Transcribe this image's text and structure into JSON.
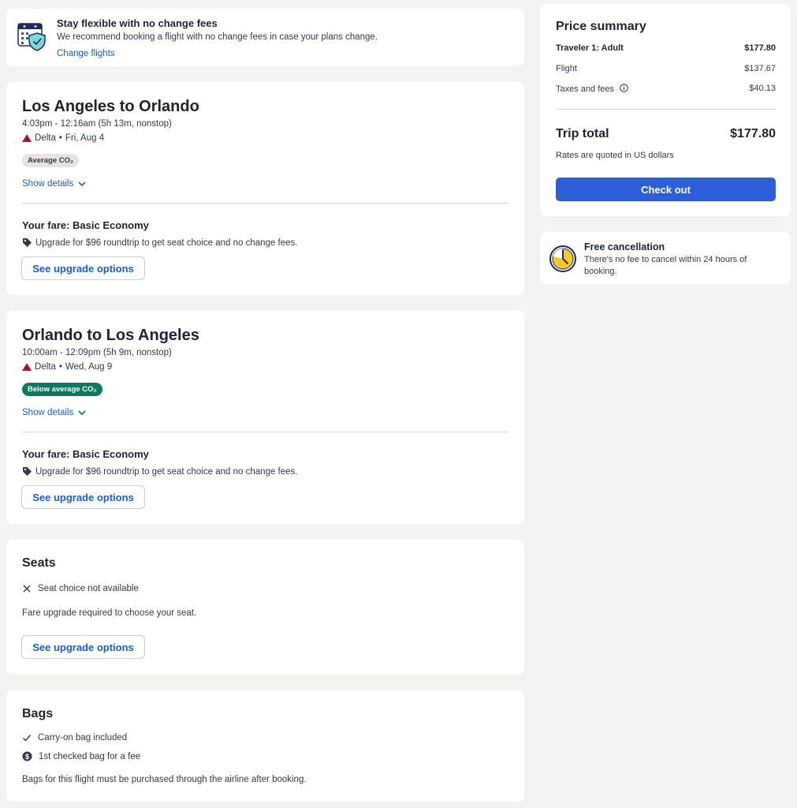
{
  "banner": {
    "title": "Stay flexible with no change fees",
    "text": "We recommend booking a flight with no change fees in case your plans change.",
    "link": "Change flights",
    "icon": "calendar-shield-icon"
  },
  "flights": [
    {
      "title": "Los Angeles to Orlando",
      "time": "4:03pm - 12:16am (5h 13m, nonstop)",
      "airline": "Delta",
      "date": "Fri, Aug 4",
      "co2_label": "Average CO₂",
      "show_details": "Show details",
      "fare": "Your fare: Basic Economy",
      "upgrade_text": "Upgrade for $96 roundtrip to get seat choice and no change fees.",
      "upgrade_button": "See upgrade options"
    },
    {
      "title": "Orlando to Los Angeles",
      "time": "10:00am - 12:09pm (5h 9m, nonstop)",
      "airline": "Delta",
      "date": "Wed, Aug 9",
      "co2_label": "Below average CO₂",
      "show_details": "Show details",
      "fare": "Your fare: Basic Economy",
      "upgrade_text": "Upgrade for $96 roundtrip to get seat choice and no change fees.",
      "upgrade_button": "See upgrade options"
    }
  ],
  "seats": {
    "title": "Seats",
    "item": "Seat choice not available",
    "note": "Fare upgrade required to choose your seat.",
    "button": "See upgrade options"
  },
  "bags": {
    "title": "Bags",
    "carry_on": "Carry-on bag included",
    "checked": "1st checked bag for a fee",
    "note": "Bags for this flight must be purchased through the airline after booking."
  },
  "price": {
    "title": "Price summary",
    "traveler_label": "Traveler 1: Adult",
    "traveler_value": "$177.80",
    "flight_label": "Flight",
    "flight_value": "$137.67",
    "taxes_label": "Taxes and fees",
    "taxes_value": "$40.13",
    "total_label": "Trip total",
    "total_value": "$177.80",
    "rates_note": "Rates are quoted in US dollars",
    "checkout": "Check out"
  },
  "free_cancellation": {
    "title": "Free cancellation",
    "text": "There's no fee to cancel within 24 hours of booking.",
    "icon": "clock-icon"
  },
  "colors": {
    "accent": "#2d5fd8",
    "link": "#1b5ec8",
    "co2_below": "#0d7a5f",
    "delta_red": "#c8102e"
  }
}
